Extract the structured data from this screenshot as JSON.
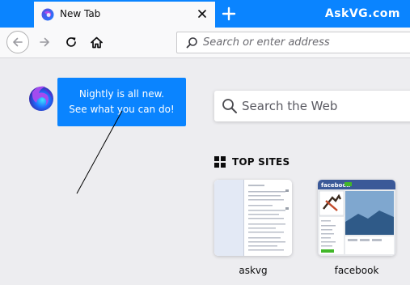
{
  "tabs": [
    {
      "title": "New Tab"
    }
  ],
  "brand": "AskVG.com",
  "urlbar": {
    "placeholder": "Search or enter address"
  },
  "callout": {
    "line1": "Nightly is all new.",
    "line2": "See what you can do!"
  },
  "search": {
    "placeholder": "Search the Web"
  },
  "top_sites": {
    "title": "TOP SITES",
    "sites": [
      {
        "label": "askvg"
      },
      {
        "label": "facebook"
      }
    ]
  },
  "facebook_thumb": {
    "brand": "facebook"
  },
  "colors": {
    "accent": "#0a84ff",
    "page_bg": "#ededf0",
    "toolbar_bg": "#f9f9fa"
  },
  "icons": [
    "firefox-nightly-icon",
    "close-icon",
    "plus-icon",
    "back-icon",
    "forward-icon",
    "reload-icon",
    "home-icon",
    "search-icon",
    "grid-icon"
  ]
}
